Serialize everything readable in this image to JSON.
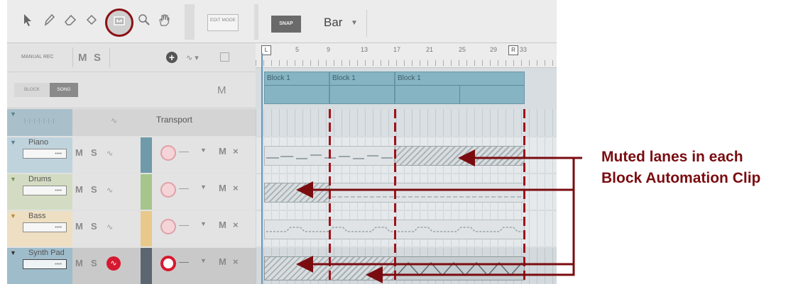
{
  "toolbar": {
    "edit_mode_label": "EDIT MODE",
    "snap_label": "SNAP",
    "snap_value": "Bar",
    "tools": [
      "arrow-icon",
      "pencil-icon",
      "eraser-icon",
      "paint-bucket-icon",
      "automation-icon",
      "magnifier-icon",
      "hand-icon"
    ]
  },
  "left_header": {
    "manual_rec": "MANUAL REC",
    "m": "M",
    "s": "S",
    "block": "BLOCK",
    "song": "SONG",
    "m2": "M"
  },
  "ruler": {
    "left_marker": "L",
    "ticks": [
      "5",
      "9",
      "13",
      "17",
      "21",
      "25",
      "29",
      "33"
    ],
    "right_marker": "R"
  },
  "blocks": [
    "Block 1",
    "Block 1",
    "Block 1"
  ],
  "tracks": [
    {
      "name": "Transport",
      "label": ""
    },
    {
      "name": "Piano",
      "label": "Piano"
    },
    {
      "name": "Drums",
      "label": "Drums"
    },
    {
      "name": "Bass",
      "label": "Bass"
    },
    {
      "name": "Synth Pad",
      "label": "Synth Pad"
    }
  ],
  "row_labels": {
    "m": "M",
    "s": "S",
    "mx_m": "M",
    "mx_x": "×"
  },
  "callout": {
    "line1": "Muted lanes in each",
    "line2": "Block Automation Clip"
  },
  "colors": {
    "accent": "#7a0c10",
    "clip": "#87b4c2",
    "synth_rec": "#d6192f"
  }
}
